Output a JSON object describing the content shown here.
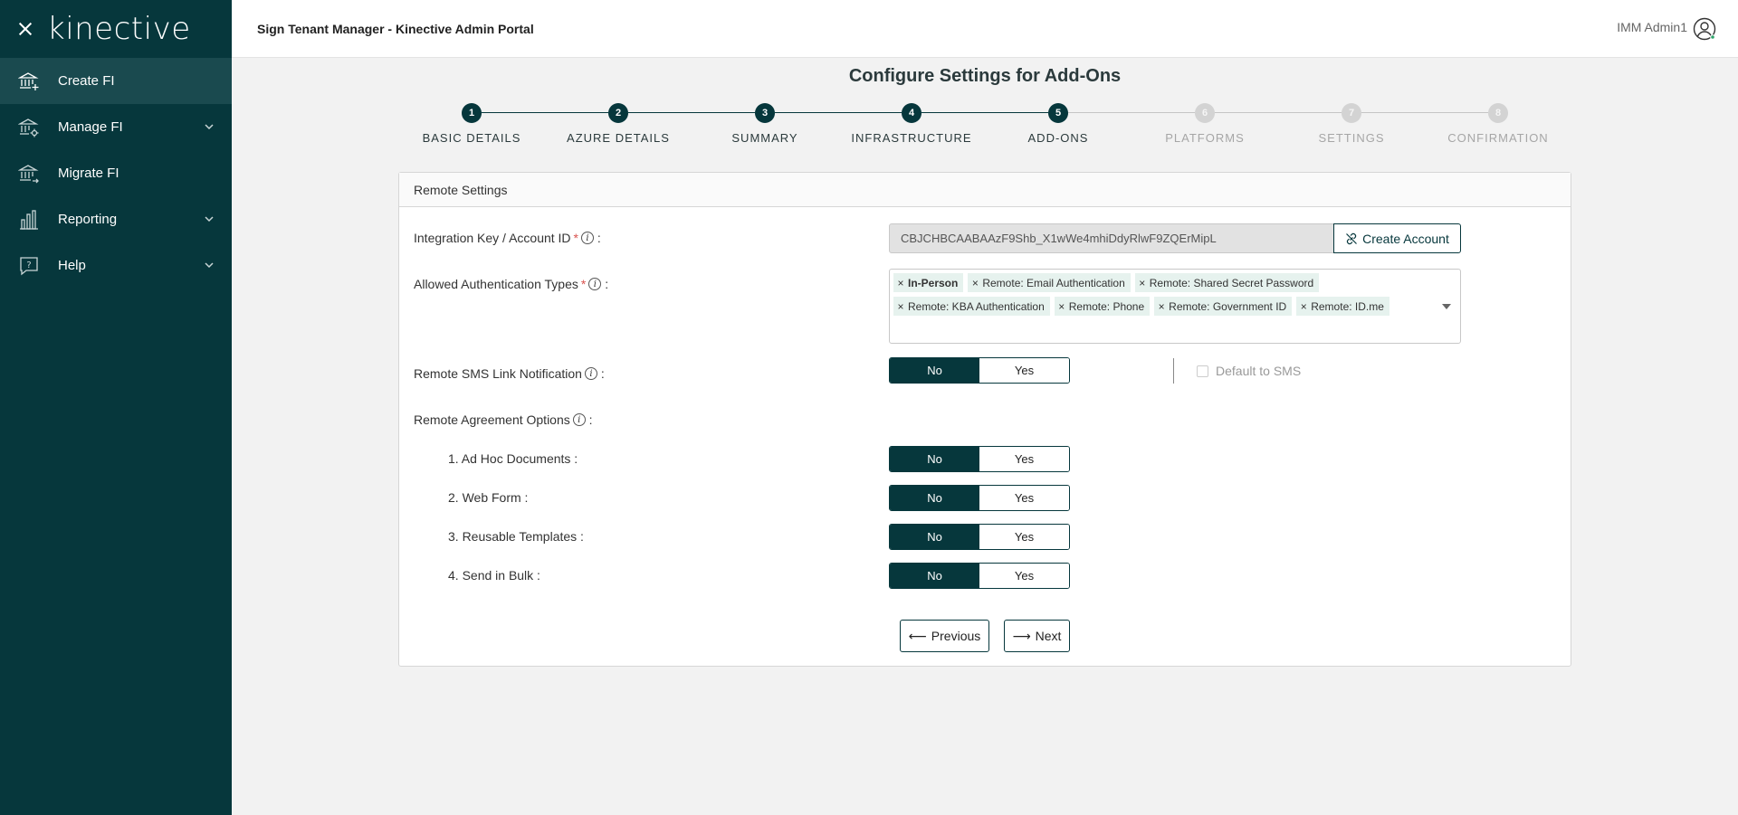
{
  "sidebar": {
    "logo": "kinective",
    "items": [
      {
        "label": "Create FI",
        "active": true,
        "has_chevron": false
      },
      {
        "label": "Manage FI",
        "active": false,
        "has_chevron": true
      },
      {
        "label": "Migrate FI",
        "active": false,
        "has_chevron": false
      },
      {
        "label": "Reporting",
        "active": false,
        "has_chevron": true
      },
      {
        "label": "Help",
        "active": false,
        "has_chevron": true
      }
    ]
  },
  "header": {
    "title": "Sign Tenant Manager - Kinective Admin Portal",
    "user": "IMM Admin1"
  },
  "page": {
    "title": "Configure Settings for Add-Ons"
  },
  "stepper": {
    "steps": [
      {
        "number": "1",
        "label": "BASIC DETAILS",
        "state": "done"
      },
      {
        "number": "2",
        "label": "AZURE DETAILS",
        "state": "done"
      },
      {
        "number": "3",
        "label": "SUMMARY",
        "state": "done"
      },
      {
        "number": "4",
        "label": "INFRASTRUCTURE",
        "state": "done"
      },
      {
        "number": "5",
        "label": "ADD-ONS",
        "state": "current"
      },
      {
        "number": "6",
        "label": "PLATFORMS",
        "state": "pending"
      },
      {
        "number": "7",
        "label": "SETTINGS",
        "state": "pending"
      },
      {
        "number": "8",
        "label": "CONFIRMATION",
        "state": "pending"
      }
    ]
  },
  "form": {
    "section_title": "Remote Settings",
    "integration_key": {
      "label": "Integration Key / Account ID",
      "colon": ":",
      "value": "CBJCHBCAABAAzF9Shb_X1wWe4mhiDdyRlwF9ZQErMipL",
      "button": "Create Account"
    },
    "auth_types": {
      "label": "Allowed Authentication Types",
      "colon": ":",
      "tags": [
        {
          "text": "In-Person",
          "bold": true
        },
        {
          "text": "Remote: Email Authentication",
          "bold": false
        },
        {
          "text": "Remote: Shared Secret Password",
          "bold": false
        },
        {
          "text": "Remote: KBA Authentication",
          "bold": false
        },
        {
          "text": "Remote: Phone",
          "bold": false
        },
        {
          "text": "Remote: Government ID",
          "bold": false
        },
        {
          "text": "Remote: ID.me",
          "bold": false
        }
      ],
      "remove_glyph": "×"
    },
    "sms_link": {
      "label": "Remote SMS Link Notification",
      "colon": ":",
      "selected": "No",
      "default_sms_label": "Default to SMS"
    },
    "agreement": {
      "label": "Remote Agreement Options",
      "colon": ":",
      "options": [
        {
          "label": "1. Ad Hoc Documents :",
          "selected": "No"
        },
        {
          "label": "2. Web Form :",
          "selected": "No"
        },
        {
          "label": "3. Reusable Templates :",
          "selected": "No"
        },
        {
          "label": "4. Send in Bulk :",
          "selected": "No"
        }
      ]
    },
    "toggle_labels": {
      "no": "No",
      "yes": "Yes"
    },
    "previous": "Previous",
    "next": "Next"
  },
  "colors": {
    "brand": "#06373c",
    "sidebar_active": "#1a4a4f",
    "tag_bg": "#e6f2ee",
    "pending": "#c4c4c4",
    "required": "#d9534f"
  }
}
